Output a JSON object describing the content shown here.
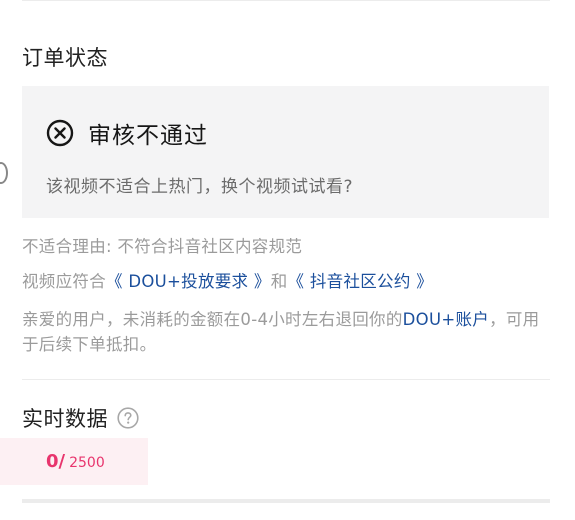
{
  "order_status": {
    "section_title": "订单状态",
    "status_title": "审核不通过",
    "status_icon": "close-circle-icon",
    "status_desc": "该视频不适合上热门，换个视频试试看?"
  },
  "reason": {
    "label": "不适合理由: 不符合抖音社区内容规范"
  },
  "policy": {
    "prefix": "视频应符合",
    "link1": "《 DOU+投放要求 》",
    "joiner": "和",
    "link2": "《 抖音社区公约 》"
  },
  "refund": {
    "text_before": "亲爱的用户，未消耗的金额在0-4小时左右退回你的",
    "account_link": "DOU+账户",
    "text_after": "，可用于后续下单抵扣。"
  },
  "realtime": {
    "section_title": "实时数据",
    "help_icon": "question-circle-icon",
    "count": "0/",
    "total": "2500"
  },
  "colors": {
    "accent_pink": "#e8356d",
    "link_blue": "#1b4f9c",
    "card_bg": "#f4f4f5"
  }
}
